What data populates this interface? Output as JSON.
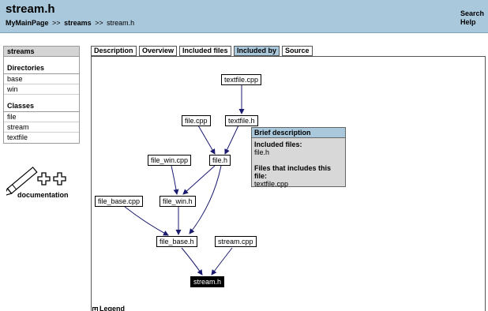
{
  "header": {
    "title": "stream.h",
    "breadcrumb": [
      "MyMainPage",
      "streams",
      "stream.h"
    ],
    "breadcrumb_sep": ">>",
    "links": [
      "Search",
      "Help"
    ]
  },
  "sidebar": {
    "title": "streams",
    "directories_heading": "Directories",
    "directories": [
      "base",
      "win"
    ],
    "classes_heading": "Classes",
    "classes": [
      "file",
      "stream",
      "textfile"
    ],
    "logo_text": "documentation"
  },
  "tabs": [
    "Description",
    "Overview",
    "Included files",
    "Included by",
    "Source"
  ],
  "active_tab": "Included by",
  "graph": {
    "nodes": {
      "textfile_cpp": "textfile.cpp",
      "file_cpp": "file.cpp",
      "textfile_h": "textfile.h",
      "file_win_cpp": "file_win.cpp",
      "file_h": "file.h",
      "file_base_cpp": "file_base.cpp",
      "file_win_h": "file_win.h",
      "file_base_h": "file_base.h",
      "stream_cpp": "stream.cpp",
      "stream_h": "stream.h"
    },
    "selected": "stream.h"
  },
  "brief": {
    "title": "Brief description",
    "included_label": "Included files:",
    "included_value": "file.h",
    "included_by_label": "Files that includes this file:",
    "included_by_value": "textfile.cpp"
  },
  "legend": {
    "toggle": "+",
    "label": "Legend"
  },
  "colors": {
    "header_bg": "#a9c8dc",
    "edge": "#1a1a6e"
  }
}
